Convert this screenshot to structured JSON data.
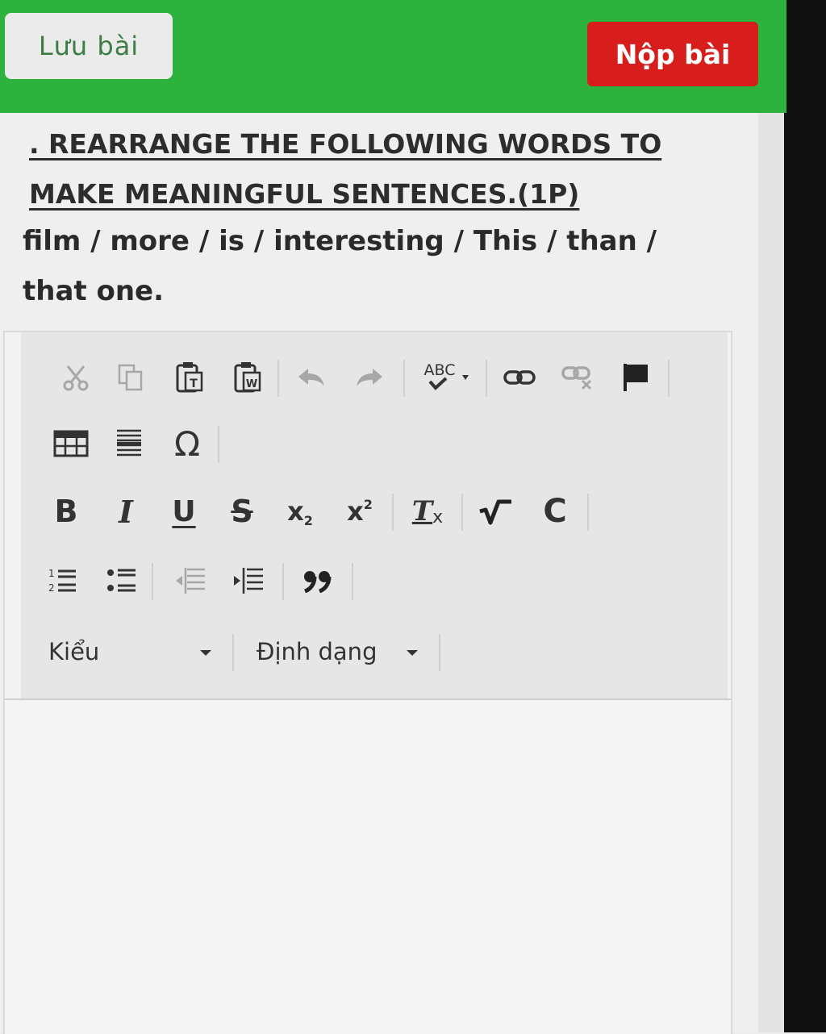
{
  "header": {
    "save_label": "Lưu bài",
    "submit_label": "Nộp bài",
    "bar_color": "#2db33d",
    "submit_color": "#d81d1d"
  },
  "question": {
    "heading": ". REARRANGE THE FOLLOWING WORDS TO MAKE MEANINGFUL SENTENCES.(1P)",
    "prompt": "film / more / is / interesting / This / than / that one."
  },
  "editor": {
    "toolbar_rows": [
      [
        "cut-icon",
        "copy-icon",
        "paste-text-icon",
        "paste-word-icon",
        "undo-icon",
        "redo-icon",
        "spellcheck-icon",
        "link-icon",
        "unlink-icon",
        "anchor-icon"
      ],
      [
        "table-icon",
        "horizontal-line-icon",
        "special-char-icon"
      ],
      [
        "bold-icon",
        "italic-icon",
        "underline-icon",
        "strikethrough-icon",
        "subscript-icon",
        "superscript-icon",
        "remove-format-icon",
        "math-icon",
        "chemistry-icon"
      ],
      [
        "numbered-list-icon",
        "bulleted-list-icon",
        "decrease-indent-icon",
        "increase-indent-icon",
        "blockquote-icon"
      ]
    ],
    "glyphs": {
      "spellcheck": "ABC",
      "special_char": "Ω",
      "bold": "B",
      "italic": "I",
      "underline": "U",
      "strike": "S",
      "subscript_base": "x",
      "subscript_sub": "2",
      "superscript_base": "x",
      "superscript_sup": "2",
      "remove_format": "T",
      "remove_format_sub": "x",
      "chemistry": "C"
    },
    "style_combo": {
      "label": "Kiểu"
    },
    "format_combo": {
      "label": "Định dạng"
    },
    "content": ""
  }
}
